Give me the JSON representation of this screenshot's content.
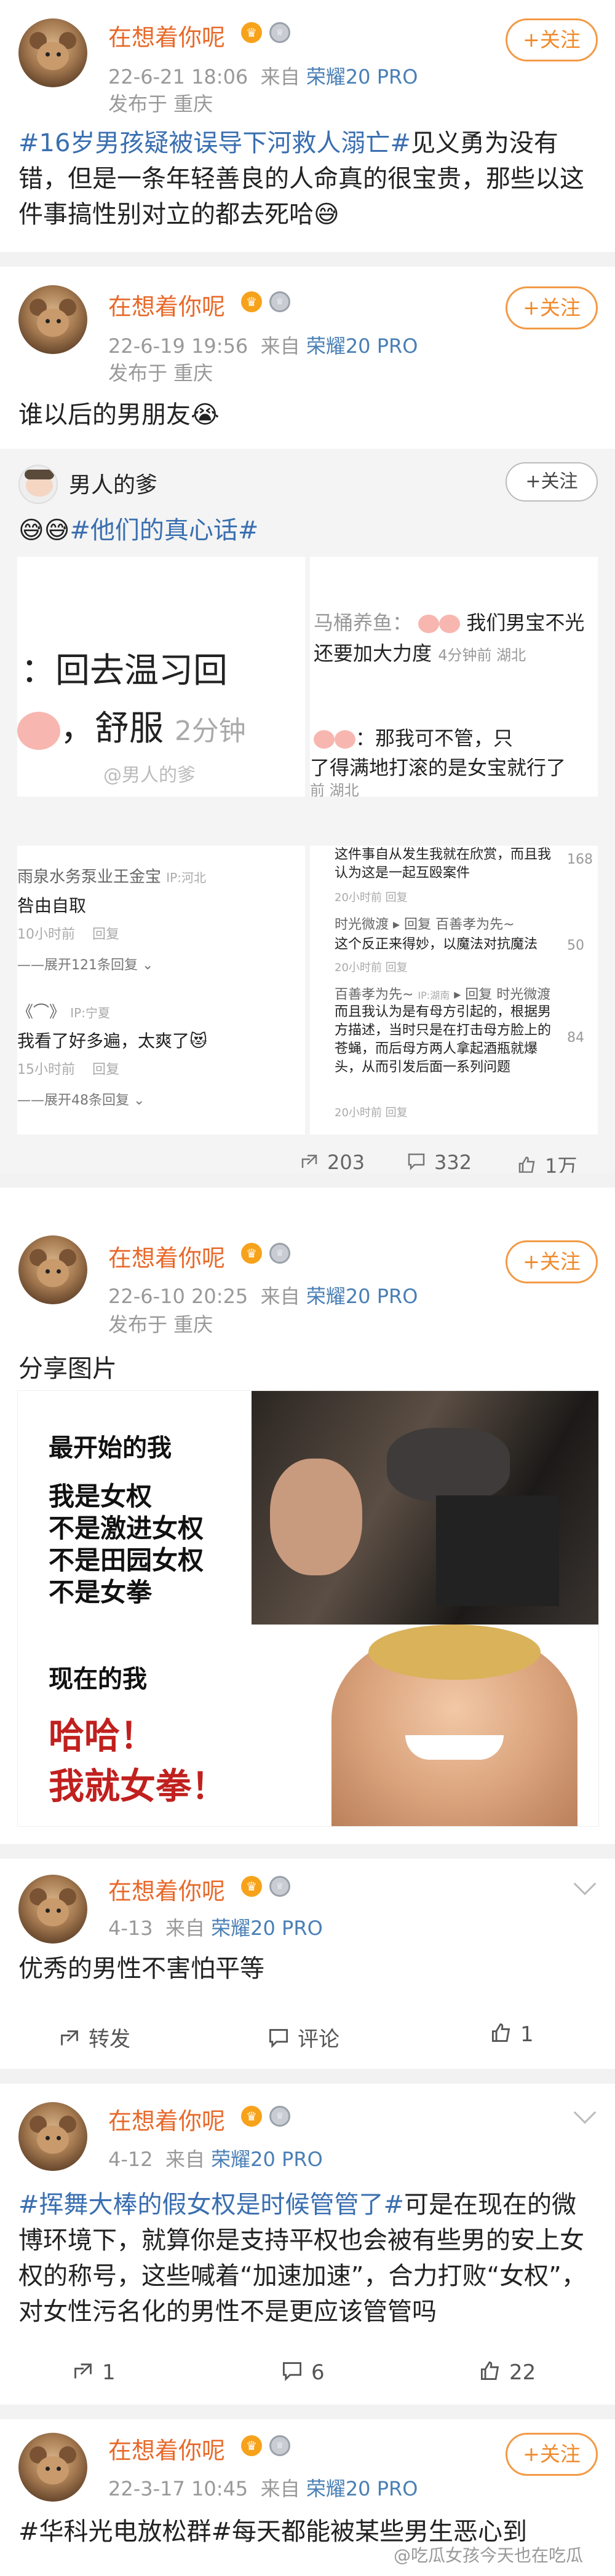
{
  "emoji": {
    "tear_smile": "😅",
    "cry": "😭",
    "heart_eyes": "😻",
    "crown": "♛",
    "medal": "♕"
  },
  "post1": {
    "username": "在想着你呢",
    "time": "22-6-21 18:06",
    "source_prefix": "来自",
    "device": "荣耀20 PRO",
    "location": "发布于 重庆",
    "follow": "+关注",
    "tag": "#16岁男孩疑被误导下河救人溺亡#",
    "body": "见义勇为没有错，但是一条年轻善良的人命真的很宝贵，那些以这件事搞性别对立的都去死哈"
  },
  "post2": {
    "username": "在想着你呢",
    "time": "22-6-19 19:56",
    "source_prefix": "来自",
    "device": "荣耀20 PRO",
    "location": "发布于 重庆",
    "follow": "+关注",
    "body": "谁以后的男朋友"
  },
  "repost": {
    "username": "男人的爹",
    "follow": "+关注",
    "tag": "#他们的真心话#",
    "img_left_text1": "：回去温习回",
    "img_left_text2": "，舒服",
    "img_left_time": "2分钟",
    "img_watermark": "@男人的爹",
    "img_right_user": "马桶养鱼：",
    "img_right_text1": "我们男宝不光",
    "img_right_text2": "还要加大力度",
    "img_right_meta": "4分钟前 湖北",
    "img_right_text3": "：那我可不管，只",
    "img_right_text4": "了得满地打滚的是女宝就行了",
    "img_right_meta2": "前 湖北",
    "c1_user": "雨泉水务泵业王金宝",
    "c1_ip": "IP:河北",
    "c1_text": "咎由自取",
    "c1_time": "10小时前",
    "c1_reply": "回复",
    "c1_expand": "展开121条回复",
    "c2_user": "《⌒》",
    "c2_ip": "IP:宁夏",
    "c2_text": "我看了好多遍，太爽了",
    "c2_time": "15小时前",
    "c2_reply": "回复",
    "c2_expand": "展开48条回复",
    "r1_text": "这件事自从发生我就在欣赏，而且我认为这是一起互殴案件",
    "r1_count": "168",
    "r1_meta": "20小时前  回复",
    "r2_user": "时光微渡",
    "r2_to": "回复",
    "r2_to_user": "百善孝为先~",
    "r2_text": "这个反正来得妙，以魔法对抗魔法",
    "r2_count": "50",
    "r2_meta": "20小时前  回复",
    "r3_user": "百善孝为先~",
    "r3_ip": "IP:湖南",
    "r3_to": "回复",
    "r3_to_user": "时光微渡",
    "r3_text": "而且我认为是有母方引起的，根据男方描述，当时只是在打击母方脸上的苍蝇，而后母方两人拿起酒瓶就爆头，从而引发后面一系列问题",
    "r3_count": "84",
    "r3_meta": "20小时前  回复",
    "stat_repost": "203",
    "stat_comment": "332",
    "stat_like": "1万"
  },
  "post3": {
    "username": "在想着你呢",
    "time": "22-6-10 20:25",
    "source_prefix": "来自",
    "device": "荣耀20 PRO",
    "location": "发布于 重庆",
    "follow": "+关注",
    "body": "分享图片",
    "meme_top_title": "最开始的我",
    "meme_top_lines": [
      "我是女权",
      "不是激进女权",
      "不是田园女权",
      "不是女拳"
    ],
    "meme_bottom_title": "现在的我",
    "meme_bottom_lines": [
      "哈哈！",
      "我就女拳！"
    ]
  },
  "post4": {
    "username": "在想着你呢",
    "time": "4-13",
    "source_prefix": "来自",
    "device": "荣耀20 PRO",
    "body": "优秀的男性不害怕平等",
    "repost_label": "转发",
    "comment_label": "评论",
    "like_count": "1"
  },
  "post5": {
    "username": "在想着你呢",
    "time": "4-12",
    "source_prefix": "来自",
    "device": "荣耀20 PRO",
    "tag": "#挥舞大棒的假女权是时候管管了#",
    "body": "可是在现在的微博环境下，就算你是支持平权也会被有些男的安上女权的称号，这些喊着“加速加速”，合力打败“女权”，对女性污名化的男性不是更应该管管吗",
    "repost_count": "1",
    "comment_count": "6",
    "like_count": "22"
  },
  "post6": {
    "username": "在想着你呢",
    "time": "22-3-17 10:45",
    "source_prefix": "来自",
    "device": "荣耀20 PRO",
    "follow": "+关注",
    "body": "#华科光电放松群#每天都能被某些男生恶心到"
  },
  "watermark": "@吃瓜女孩今天也在吃瓜"
}
